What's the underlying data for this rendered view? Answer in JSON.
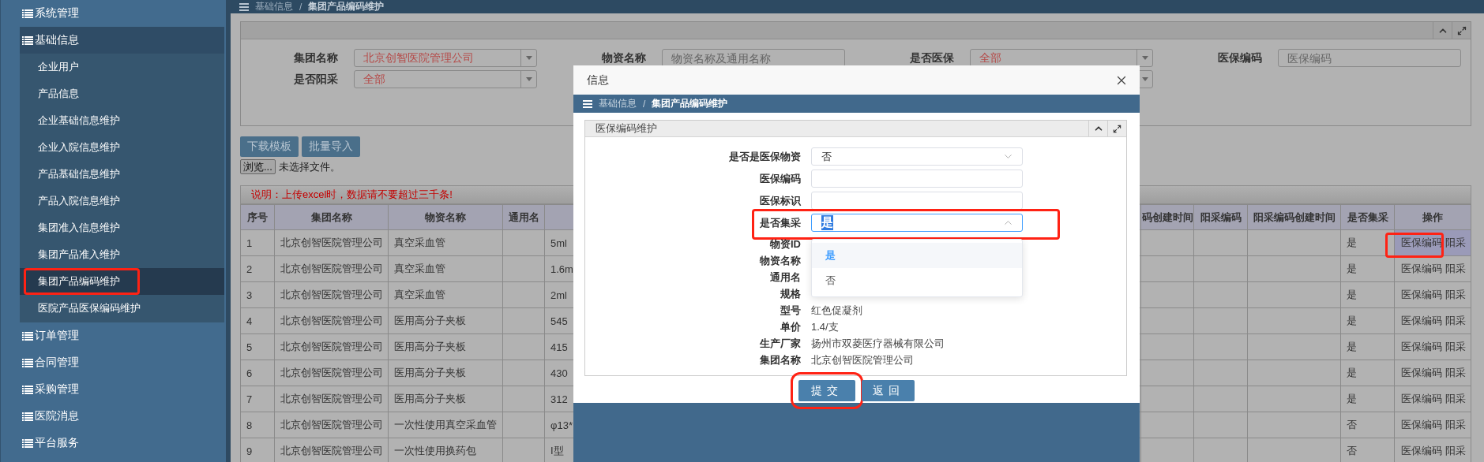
{
  "sidebar": {
    "items": [
      {
        "label": "系统管理"
      },
      {
        "label": "基础信息",
        "children": [
          {
            "label": "企业用户",
            "selected": false,
            "highlighted": false
          },
          {
            "label": "产品信息",
            "selected": false,
            "highlighted": false
          },
          {
            "label": "企业基础信息维护",
            "selected": false,
            "highlighted": false
          },
          {
            "label": "企业入院信息维护",
            "selected": false,
            "highlighted": false
          },
          {
            "label": "产品基础信息维护",
            "selected": false,
            "highlighted": false
          },
          {
            "label": "产品入院信息维护",
            "selected": false,
            "highlighted": false
          },
          {
            "label": "集团准入信息维护",
            "selected": false,
            "highlighted": false
          },
          {
            "label": "集团产品准入维护",
            "selected": false,
            "highlighted": false
          },
          {
            "label": "集团产品编码维护",
            "selected": true,
            "highlighted": true
          },
          {
            "label": "医院产品医保编码维护",
            "selected": false,
            "highlighted": false
          }
        ]
      },
      {
        "label": "订单管理"
      },
      {
        "label": "合同管理"
      },
      {
        "label": "采购管理"
      },
      {
        "label": "医院消息"
      },
      {
        "label": "平台服务"
      }
    ]
  },
  "breadcrumb": {
    "items": [
      "基础信息",
      "集团产品编码维护"
    ],
    "separator": "/"
  },
  "filter_panel": {
    "rows": [
      [
        {
          "kind": "select",
          "label": "集团名称",
          "value": "北京创智医院管理公司"
        },
        {
          "kind": "input",
          "label": "物资名称",
          "placeholder": "物资名称及通用名称"
        },
        {
          "kind": "select",
          "label": "是否医保",
          "value": "全部"
        },
        {
          "kind": "input",
          "label": "医保编码",
          "placeholder": "医保编码"
        }
      ],
      [
        {
          "kind": "select",
          "label": "是否阳采",
          "value": "全部"
        },
        {
          "kind": "empty"
        },
        {
          "kind": "select"
        }
      ]
    ]
  },
  "buttons": [
    "下载模板",
    "批量导入"
  ],
  "file_input": {
    "button": "浏览...",
    "status": "未选择文件。"
  },
  "notice": "说明：上传excel时，数据请不要超过三千条!",
  "table": {
    "columns_left": [
      "序号",
      "集团名称",
      "物资名称",
      "通用名"
    ],
    "columns_right": [
      "码创建时间",
      "阳采编码",
      "阳采编码创建时间",
      "是否集采",
      "操作"
    ],
    "rows": [
      {
        "序号": "1",
        "集团名称": "北京创智医院管理公司",
        "物资名称": "真空采血管",
        "column_5": "5ml",
        "是否集采": "是",
        "操作": [
          "医保编码",
          "阳采"
        ],
        "highlighted": true
      },
      {
        "序号": "2",
        "集团名称": "北京创智医院管理公司",
        "物资名称": "真空采血管",
        "column_5": "1.6m",
        "是否集采": "是",
        "操作": [
          "医保编码",
          "阳采"
        ],
        "highlighted": false
      },
      {
        "序号": "3",
        "集团名称": "北京创智医院管理公司",
        "物资名称": "真空采血管",
        "column_5": "2ml",
        "是否集采": "是",
        "操作": [
          "医保编码",
          "阳采"
        ],
        "highlighted": false
      },
      {
        "序号": "4",
        "集团名称": "北京创智医院管理公司",
        "物资名称": "医用高分子夹板",
        "column_5": "545",
        "是否集采": "是",
        "操作": [
          "医保编码",
          "阳采"
        ],
        "highlighted": false
      },
      {
        "序号": "5",
        "集团名称": "北京创智医院管理公司",
        "物资名称": "医用高分子夹板",
        "column_5": "415",
        "是否集采": "是",
        "操作": [
          "医保编码",
          "阳采"
        ],
        "highlighted": false
      },
      {
        "序号": "6",
        "集团名称": "北京创智医院管理公司",
        "物资名称": "医用高分子夹板",
        "column_5": "430",
        "是否集采": "是",
        "操作": [
          "医保编码",
          "阳采"
        ],
        "highlighted": false
      },
      {
        "序号": "7",
        "集团名称": "北京创智医院管理公司",
        "物资名称": "医用高分子夹板",
        "column_5": "312",
        "是否集采": "是",
        "操作": [
          "医保编码",
          "阳采"
        ],
        "highlighted": false
      },
      {
        "序号": "8",
        "集团名称": "北京创智医院管理公司",
        "物资名称": "一次性使用真空采血管",
        "column_5": "φ13*",
        "是否集采": "否",
        "操作": [
          "医保编码",
          "阳采"
        ],
        "highlighted": false
      },
      {
        "序号": "9",
        "集团名称": "北京创智医院管理公司",
        "物资名称": "一次性使用换药包",
        "column_5": "I型",
        "是否集采": "否",
        "操作": [
          "医保编码",
          "阳采"
        ],
        "highlighted": false
      }
    ]
  },
  "dialog": {
    "title": "信息",
    "breadcrumb": {
      "items": [
        "基础信息",
        "集团产品编码维护"
      ],
      "separator": "/"
    },
    "panel_title": "医保编码维护",
    "fields": [
      {
        "kind": "select",
        "label": "是否是医保物资",
        "value": "否",
        "open": false,
        "highlighted": false
      },
      {
        "kind": "input",
        "label": "医保编码"
      },
      {
        "kind": "input",
        "label": "医保标识"
      },
      {
        "kind": "select",
        "label": "是否集采",
        "value": "是",
        "open": true,
        "highlighted": true,
        "options": [
          {
            "label": "是",
            "selected": true
          },
          {
            "label": "否",
            "selected": false
          }
        ]
      },
      {
        "kind": "text",
        "label": "物资ID"
      },
      {
        "kind": "text",
        "label": "物资名称"
      },
      {
        "kind": "text",
        "label": "通用名"
      },
      {
        "kind": "text",
        "label": "规格"
      },
      {
        "kind": "text",
        "label": "型号",
        "value": "红色促凝剂"
      },
      {
        "kind": "text",
        "label": "单价",
        "value": "1.4/支"
      },
      {
        "kind": "text",
        "label": "生产厂家",
        "value": "扬州市双菱医疗器械有限公司"
      },
      {
        "kind": "text",
        "label": "集团名称",
        "value": "北京创智医院管理公司"
      }
    ],
    "buttons": [
      {
        "label": "提交",
        "highlighted": true
      },
      {
        "label": "返回",
        "highlighted": false
      }
    ]
  }
}
